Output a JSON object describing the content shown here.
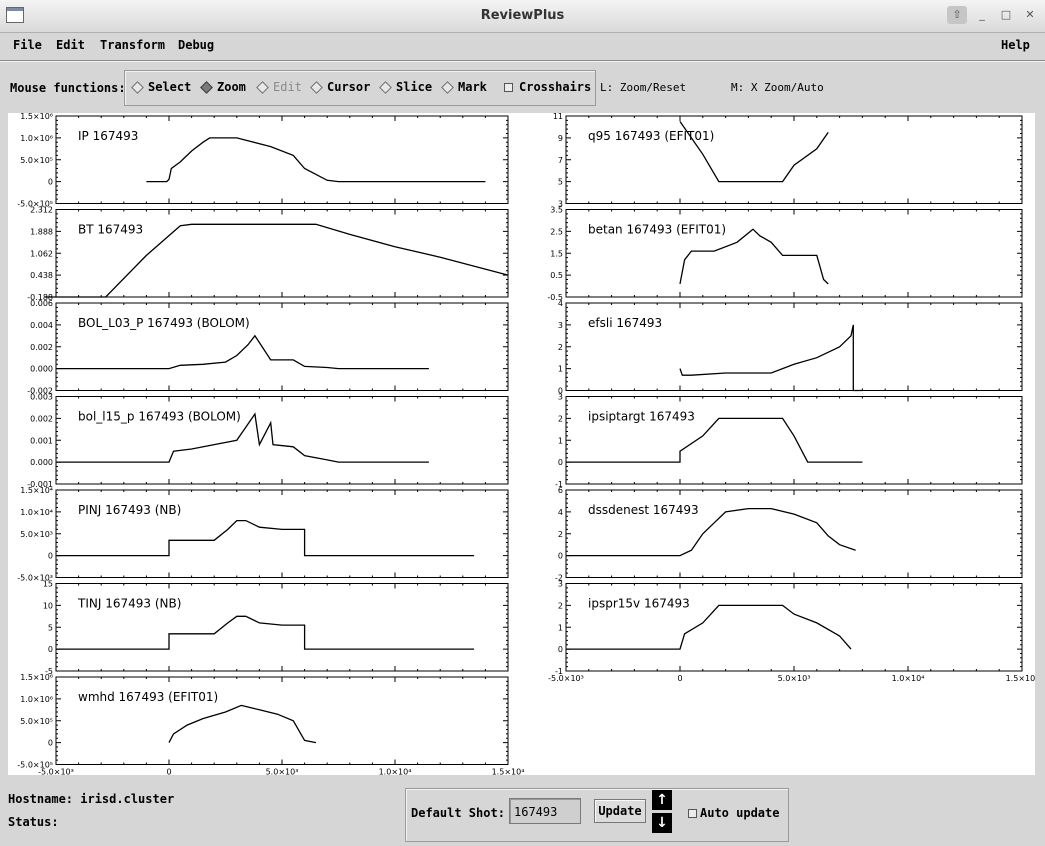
{
  "window": {
    "title": "ReviewPlus",
    "controls": [
      "⇧",
      "_",
      "□",
      "✕"
    ]
  },
  "menu": {
    "file": "File",
    "edit": "Edit",
    "transform": "Transform",
    "debug": "Debug",
    "help": "Help"
  },
  "toolbar": {
    "label": "Mouse functions:",
    "modes": [
      {
        "label": "Select",
        "selected": false,
        "enabled": true
      },
      {
        "label": "Zoom",
        "selected": true,
        "enabled": true
      },
      {
        "label": "Edit",
        "selected": false,
        "enabled": false
      },
      {
        "label": "Cursor",
        "selected": false,
        "enabled": true
      },
      {
        "label": "Slice",
        "selected": false,
        "enabled": true
      },
      {
        "label": "Mark",
        "selected": false,
        "enabled": true
      }
    ],
    "crosshairs": "Crosshairs",
    "hint_l": "L: Zoom/Reset",
    "hint_m": "M: X Zoom/Auto"
  },
  "chart_data": [
    {
      "type": "line",
      "title": "IP 167493",
      "ticks": [
        "1.5×10⁶",
        "1.0×10⁶",
        "5.0×10⁵",
        "0",
        "-5.0×10⁵"
      ],
      "ylim": [
        -500000,
        1500000
      ],
      "x": [
        -1000,
        -100,
        0,
        100,
        500,
        1000,
        1500,
        1800,
        2000,
        3000,
        4500,
        5500,
        6000,
        7000,
        7500,
        10000,
        14000
      ],
      "y": [
        0,
        0,
        50000,
        300000,
        450000,
        700000,
        900000,
        1000000,
        1000000,
        1000000,
        800000,
        600000,
        300000,
        30000,
        0,
        0,
        0
      ]
    },
    {
      "type": "line",
      "title": "BT 167493",
      "ticks": [
        "2.312",
        "1.888",
        "1.062",
        "0.438",
        "-0.188"
      ],
      "ylim": [
        -0.188,
        2.312
      ],
      "x": [
        -5500,
        -2800,
        -1000,
        500,
        1000,
        5000,
        6500,
        8000,
        10000,
        12000,
        15000
      ],
      "y": [
        -0.188,
        -0.188,
        1.0,
        1.85,
        1.888,
        1.888,
        1.888,
        1.6,
        1.25,
        0.95,
        0.438
      ]
    },
    {
      "type": "line",
      "title": "BOL_L03_P 167493 (BOLOM)",
      "ticks": [
        "0.006",
        "0.004",
        "0.002",
        "0.000",
        "-0.002"
      ],
      "ylim": [
        -0.002,
        0.006
      ],
      "x": [
        -5000,
        -1000,
        0,
        500,
        1500,
        2500,
        3000,
        3500,
        3800,
        4500,
        5500,
        6000,
        7000,
        7500,
        11500
      ],
      "y": [
        0,
        0,
        0,
        0.0003,
        0.0004,
        0.0006,
        0.0012,
        0.0022,
        0.003,
        0.0008,
        0.0008,
        0.0002,
        0.0001,
        0,
        0
      ]
    },
    {
      "type": "line",
      "title": "bol_l15_p 167493 (BOLOM)",
      "ticks": [
        "0.003",
        "0.002",
        "0.001",
        "0.000",
        "-0.001"
      ],
      "ylim": [
        -0.001,
        0.003
      ],
      "x": [
        -5000,
        -1000,
        0,
        200,
        1000,
        2000,
        3000,
        3800,
        4000,
        4500,
        4600,
        5500,
        6000,
        7000,
        7500,
        11500
      ],
      "y": [
        0,
        0,
        0,
        0.0005,
        0.0006,
        0.0008,
        0.001,
        0.0022,
        0.0008,
        0.0018,
        0.0008,
        0.0007,
        0.0003,
        0.0001,
        0,
        0
      ]
    },
    {
      "type": "line",
      "title": "PINJ 167493 (NB)",
      "ticks": [
        "1.5×10⁴",
        "1.0×10⁴",
        "5.0×10³",
        "0",
        "-5.0×10³"
      ],
      "ylim": [
        -5000,
        15000
      ],
      "x": [
        -5000,
        -100,
        0,
        0,
        1000,
        2000,
        2600,
        3000,
        3400,
        4000,
        5000,
        6000,
        6000,
        13500
      ],
      "y": [
        0,
        0,
        0,
        3500,
        3500,
        3500,
        6000,
        8000,
        8000,
        6500,
        6000,
        6000,
        0,
        0
      ]
    },
    {
      "type": "line",
      "title": "TINJ 167493 (NB)",
      "ticks": [
        "15",
        "10",
        "5",
        "0",
        "-5"
      ],
      "ylim": [
        -5,
        15
      ],
      "x": [
        -5000,
        -100,
        0,
        0,
        1000,
        2000,
        2600,
        3000,
        3400,
        4000,
        5000,
        6000,
        6000,
        13500
      ],
      "y": [
        0,
        0,
        0,
        3.5,
        3.5,
        3.5,
        6,
        7.5,
        7.5,
        6,
        5.5,
        5.5,
        0,
        0
      ]
    },
    {
      "type": "line",
      "title": "wmhd 167493 (EFIT01)",
      "ticks": [
        "1.5×10⁶",
        "1.0×10⁶",
        "5.0×10⁵",
        "0",
        "-5.0×10⁵"
      ],
      "ylim": [
        -500000,
        1500000
      ],
      "x": [
        0,
        200,
        800,
        1500,
        2500,
        3200,
        4000,
        4800,
        5500,
        6000,
        6500
      ],
      "y": [
        0,
        200000,
        400000,
        550000,
        700000,
        850000,
        750000,
        650000,
        500000,
        50000,
        0
      ]
    },
    {
      "type": "line",
      "title": "q95 167493 (EFIT01)",
      "ticks": [
        "11",
        "9",
        "7",
        "5",
        "3"
      ],
      "ylim": [
        3,
        11
      ],
      "x": [
        0,
        1000,
        1700,
        2000,
        3000,
        4500,
        5000,
        6000,
        6500
      ],
      "y": [
        10.5,
        7.5,
        5,
        5,
        5,
        5,
        6.5,
        8,
        9.5
      ]
    },
    {
      "type": "line",
      "title": "betan 167493 (EFIT01)",
      "ticks": [
        "3.5",
        "2.5",
        "1.5",
        "0.5",
        "-0.5"
      ],
      "ylim": [
        -0.5,
        3.5
      ],
      "x": [
        0,
        200,
        500,
        1500,
        2500,
        3200,
        3500,
        4000,
        4500,
        5000,
        6000,
        6300,
        6500
      ],
      "y": [
        0.1,
        1.2,
        1.6,
        1.6,
        2.0,
        2.6,
        2.3,
        2.0,
        1.4,
        1.4,
        1.4,
        0.3,
        0.1
      ]
    },
    {
      "type": "line",
      "title": "efsli 167493",
      "ticks": [
        "4",
        "3",
        "2",
        "1",
        "0"
      ],
      "ylim": [
        0,
        4
      ],
      "x": [
        0,
        100,
        500,
        2000,
        4000,
        5000,
        6000,
        7000,
        7500,
        7600,
        7600,
        8000
      ],
      "y": [
        1,
        0.7,
        0.7,
        0.8,
        0.8,
        1.2,
        1.5,
        2.0,
        2.5,
        3.0,
        0,
        0
      ]
    },
    {
      "type": "line",
      "title": "ipsiptargt 167493",
      "ticks": [
        "3",
        "2",
        "1",
        "0",
        "-1"
      ],
      "ylim": [
        -1,
        3
      ],
      "x": [
        -5000,
        0,
        0,
        1000,
        1700,
        3000,
        4500,
        5000,
        5600,
        8000
      ],
      "y": [
        0,
        0,
        0.5,
        1.2,
        2,
        2,
        2,
        1.2,
        0,
        0
      ]
    },
    {
      "type": "line",
      "title": "dssdenest 167493",
      "ticks": [
        "6",
        "4",
        "2",
        "0",
        "-2"
      ],
      "ylim": [
        -2,
        6
      ],
      "x": [
        -5000,
        0,
        500,
        1000,
        1500,
        2000,
        3000,
        4000,
        5000,
        6000,
        6500,
        7000,
        7700
      ],
      "y": [
        0,
        0,
        0.5,
        2,
        3,
        4,
        4.3,
        4.3,
        3.8,
        3,
        1.8,
        1.0,
        0.5
      ]
    },
    {
      "type": "line",
      "title": "ipspr15v 167493",
      "ticks": [
        "3",
        "2",
        "1",
        "0",
        "-1"
      ],
      "ylim": [
        -1,
        3
      ],
      "x": [
        -5000,
        0,
        200,
        1000,
        1700,
        3000,
        4500,
        5000,
        6000,
        7000,
        7500
      ],
      "y": [
        0,
        0,
        0.7,
        1.2,
        2,
        2,
        2,
        1.6,
        1.2,
        0.6,
        0
      ]
    }
  ],
  "x_axis": {
    "ticks": [
      "-5.0×10³",
      "0",
      "5.0×10³",
      "1.0×10⁴",
      "1.5×10⁴"
    ],
    "xlim": [
      -5000,
      15000
    ]
  },
  "status": {
    "host_label": "Hostname: irisd.cluster",
    "status_label": "Status:"
  },
  "shot": {
    "label": "Default Shot:",
    "value": "167493",
    "update": "Update",
    "auto_update": "Auto update",
    "up_arrow": "↑",
    "down_arrow": "↓"
  }
}
